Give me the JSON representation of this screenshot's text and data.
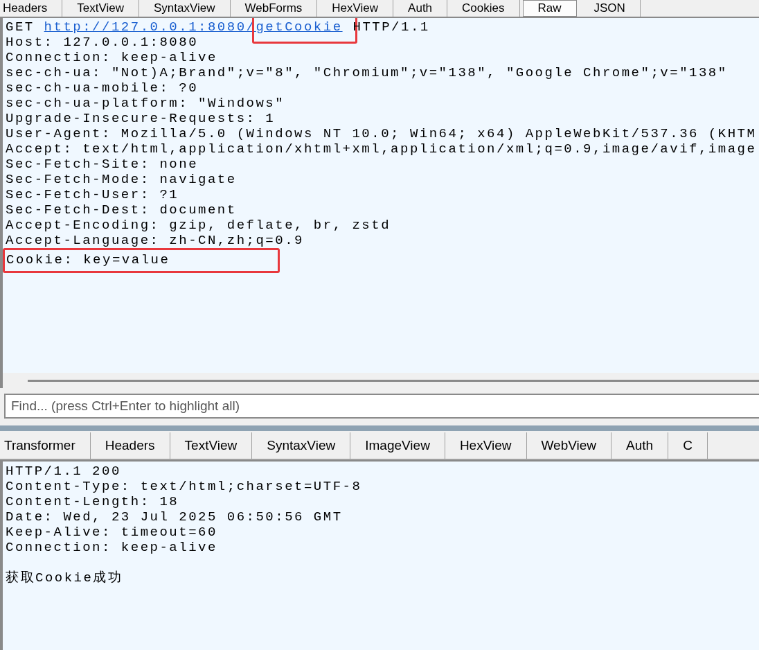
{
  "request_tabs": [
    {
      "label": "Headers",
      "selected": false
    },
    {
      "label": "TextView",
      "selected": false
    },
    {
      "label": "SyntaxView",
      "selected": false
    },
    {
      "label": "WebForms",
      "selected": false
    },
    {
      "label": "HexView",
      "selected": false
    },
    {
      "label": "Auth",
      "selected": false
    },
    {
      "label": "Cookies",
      "selected": false
    },
    {
      "label": "Raw",
      "selected": true
    },
    {
      "label": "JSON",
      "selected": false
    }
  ],
  "request_lines": [
    {
      "segments": [
        {
          "text": "GET ",
          "kind": "plain",
          "highlighted": false
        },
        {
          "text": "http://127.0.0.1:8080/",
          "kind": "link",
          "highlighted": false
        },
        {
          "text": "getCookie",
          "kind": "link",
          "highlighted": true
        },
        {
          "text": " HTTP/1.1",
          "kind": "plain",
          "highlighted": false
        }
      ]
    },
    {
      "text": "Host: 127.0.0.1:8080",
      "highlighted": false
    },
    {
      "text": "Connection: keep-alive",
      "highlighted": false
    },
    {
      "text": "sec-ch-ua: \"Not)A;Brand\";v=\"8\", \"Chromium\";v=\"138\", \"Google Chrome\";v=\"138\"",
      "highlighted": false
    },
    {
      "text": "sec-ch-ua-mobile: ?0",
      "highlighted": false
    },
    {
      "text": "sec-ch-ua-platform: \"Windows\"",
      "highlighted": false
    },
    {
      "text": "Upgrade-Insecure-Requests: 1",
      "highlighted": false
    },
    {
      "text": "User-Agent: Mozilla/5.0 (Windows NT 10.0; Win64; x64) AppleWebKit/537.36 (KHTM",
      "highlighted": false
    },
    {
      "text": "Accept: text/html,application/xhtml+xml,application/xml;q=0.9,image/avif,image",
      "highlighted": false
    },
    {
      "text": "Sec-Fetch-Site: none",
      "highlighted": false
    },
    {
      "text": "Sec-Fetch-Mode: navigate",
      "highlighted": false
    },
    {
      "text": "Sec-Fetch-User: ?1",
      "highlighted": false
    },
    {
      "text": "Sec-Fetch-Dest: document",
      "highlighted": false
    },
    {
      "text": "Accept-Encoding: gzip, deflate, br, zstd",
      "highlighted": false
    },
    {
      "text": "Accept-Language: zh-CN,zh;q=0.9",
      "highlighted": false
    },
    {
      "text": "Cookie: key=value",
      "highlighted": true
    }
  ],
  "find": {
    "placeholder": "Find... (press Ctrl+Enter to highlight all)"
  },
  "response_tabs": [
    {
      "label": "Transformer",
      "selected": false
    },
    {
      "label": "Headers",
      "selected": false
    },
    {
      "label": "TextView",
      "selected": false
    },
    {
      "label": "SyntaxView",
      "selected": false
    },
    {
      "label": "ImageView",
      "selected": false
    },
    {
      "label": "HexView",
      "selected": false
    },
    {
      "label": "WebView",
      "selected": false
    },
    {
      "label": "Auth",
      "selected": false
    },
    {
      "label": "C",
      "selected": false
    }
  ],
  "response_headers": [
    "HTTP/1.1 200",
    "Content-Type: text/html;charset=UTF-8",
    "Content-Length: 18",
    "Date: Wed, 23 Jul 2025 06:50:56 GMT",
    "Keep-Alive: timeout=60",
    "Connection: keep-alive"
  ],
  "response_body": "获取Cookie成功"
}
